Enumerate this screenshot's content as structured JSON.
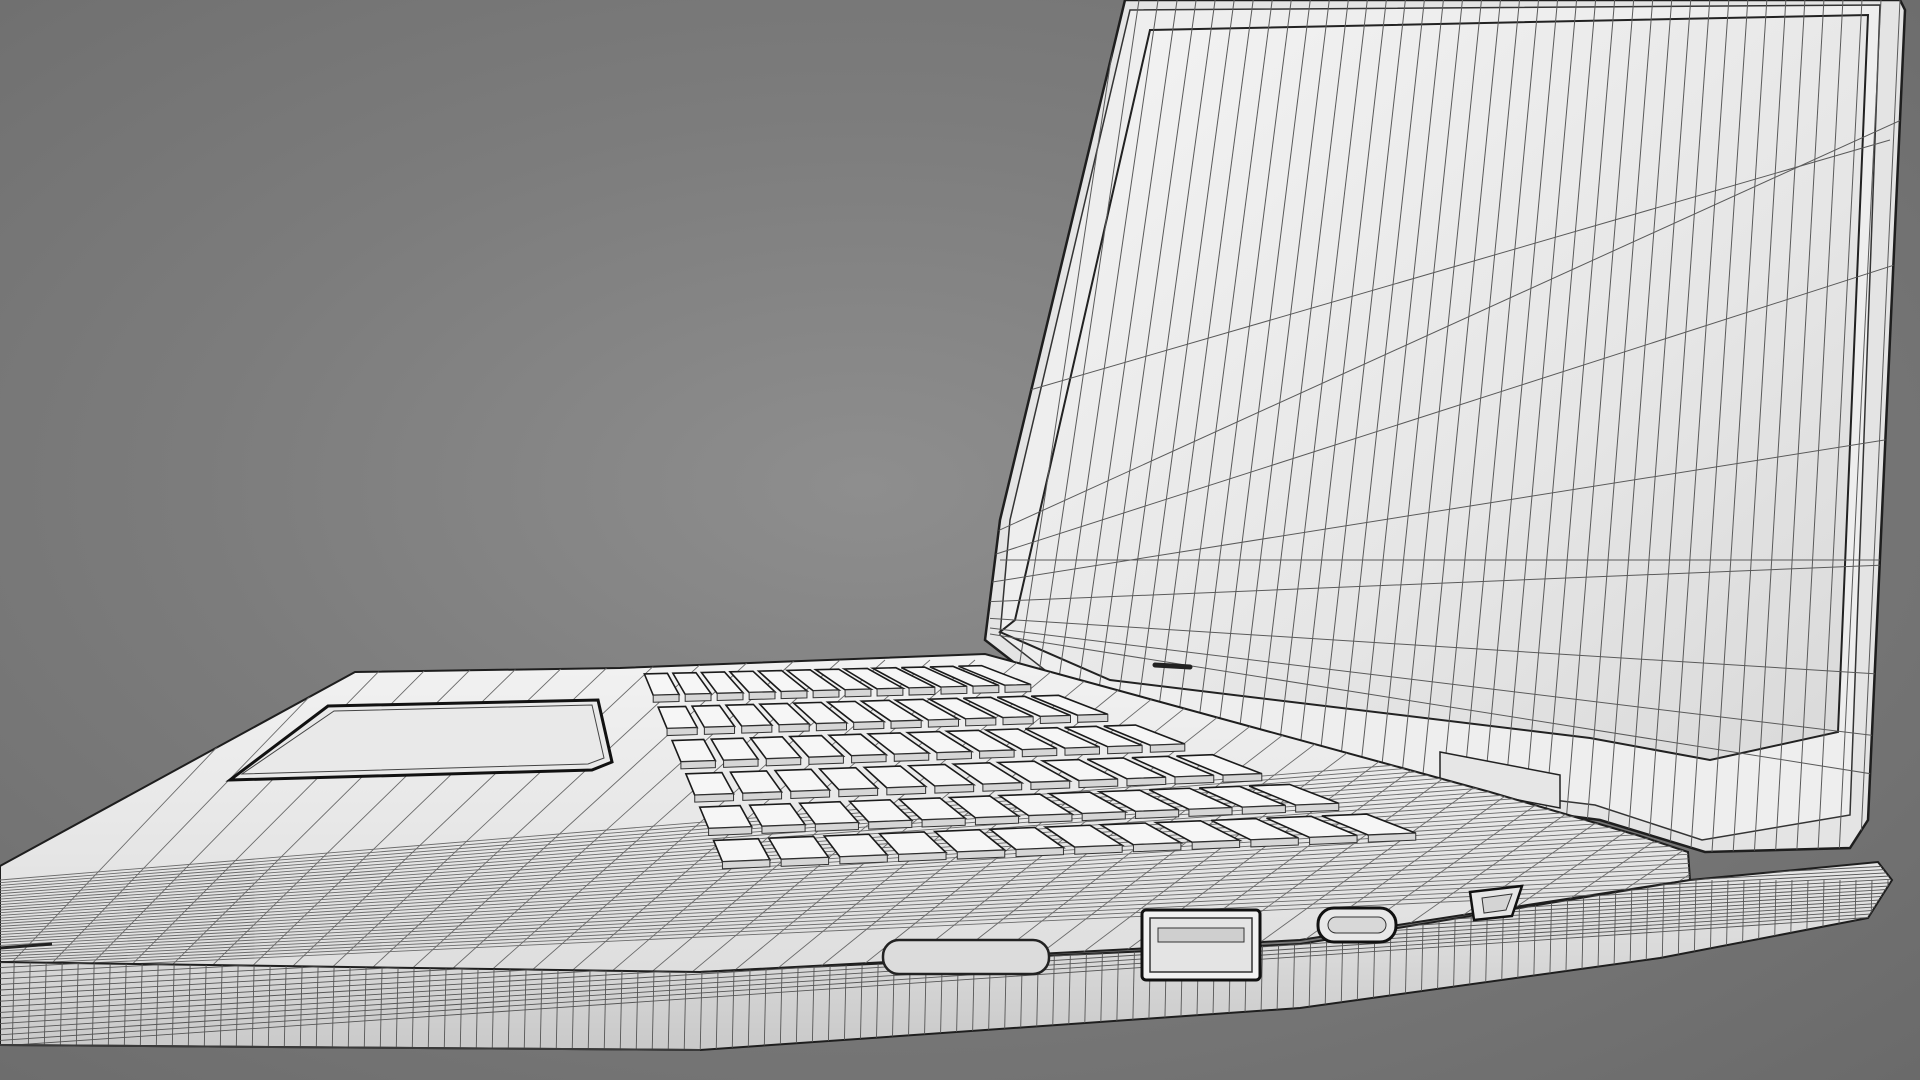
{
  "scene": {
    "subject": "laptop-wireframe-render",
    "background_color": "#7f7f7f",
    "surface_color": "#efefef",
    "wire_color": "#2a2a2a",
    "keys": {
      "rows": 6,
      "columns": 12
    }
  }
}
